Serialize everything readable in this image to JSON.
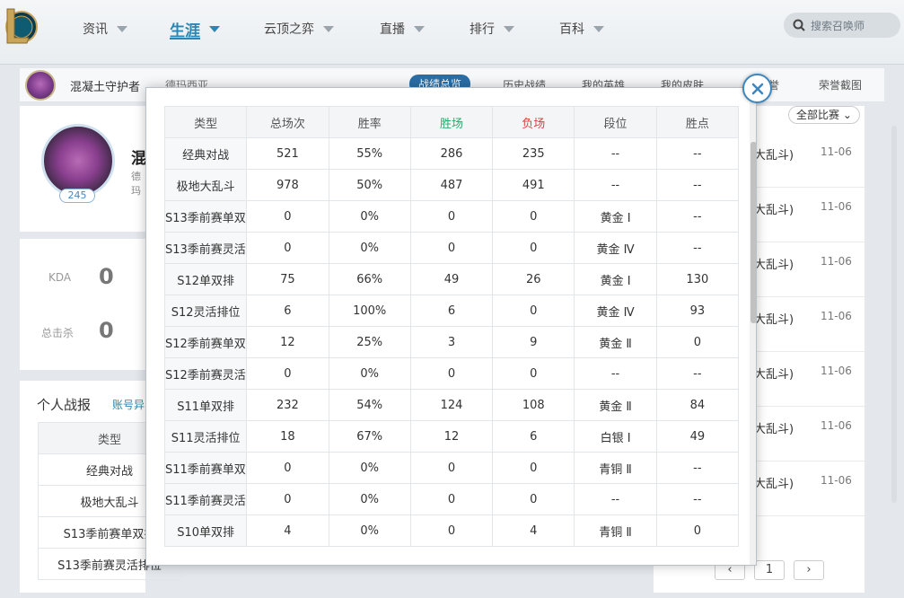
{
  "nav": {
    "items": [
      {
        "label": "资讯"
      },
      {
        "label": "生涯"
      },
      {
        "label": "云顶之弈"
      },
      {
        "label": "直播"
      },
      {
        "label": "排行"
      },
      {
        "label": "百科"
      }
    ],
    "search_placeholder": "搜索召唤师",
    "active_color": "#2b86b3"
  },
  "profile_bar": {
    "name": "混凝土守护者",
    "server": "德玛西亚",
    "tabs": [
      "战绩总览",
      "历史战绩",
      "我的英雄",
      "我的皮肤",
      "荣誉",
      "荣誉截图"
    ]
  },
  "summoner": {
    "name": "混",
    "sub": "德玛",
    "level": "245"
  },
  "kda": {
    "kda_label": "KDA",
    "kda_value": "0",
    "kills_label": "总击杀",
    "kills_value": "0"
  },
  "report": {
    "title": "个人战报",
    "link": "账号异",
    "header": "类型",
    "rows": [
      "经典对战",
      "极地大乱斗",
      "S13季前赛单双排",
      "S13季前赛灵活排位"
    ]
  },
  "matches": {
    "filter": "全部比赛",
    "rows": [
      {
        "mode": "大乱斗)",
        "date": "11-06"
      },
      {
        "mode": "大乱斗)",
        "date": "11-06"
      },
      {
        "mode": "大乱斗)",
        "date": "11-06"
      },
      {
        "mode": "大乱斗)",
        "date": "11-06"
      },
      {
        "mode": "大乱斗)",
        "date": "11-06"
      },
      {
        "mode": "大乱斗)",
        "date": "11-06"
      },
      {
        "mode": "大乱斗)",
        "date": "11-06"
      }
    ],
    "page": "1"
  },
  "modal": {
    "headers": [
      "类型",
      "总场次",
      "胜率",
      "胜场",
      "负场",
      "段位",
      "胜点"
    ],
    "win_color": "#2fa86b",
    "loss_color": "#e04040",
    "rows": [
      [
        "经典对战",
        "521",
        "55%",
        "286",
        "235",
        "--",
        "--"
      ],
      [
        "极地大乱斗",
        "978",
        "50%",
        "487",
        "491",
        "--",
        "--"
      ],
      [
        "S13季前赛单双排",
        "0",
        "0%",
        "0",
        "0",
        "黄金 Ⅰ",
        "--"
      ],
      [
        "S13季前赛灵活排位",
        "0",
        "0%",
        "0",
        "0",
        "黄金 Ⅳ",
        "--"
      ],
      [
        "S12单双排",
        "75",
        "66%",
        "49",
        "26",
        "黄金 Ⅰ",
        "130"
      ],
      [
        "S12灵活排位",
        "6",
        "100%",
        "6",
        "0",
        "黄金 Ⅳ",
        "93"
      ],
      [
        "S12季前赛单双排",
        "12",
        "25%",
        "3",
        "9",
        "黄金 Ⅱ",
        "0"
      ],
      [
        "S12季前赛灵活排位",
        "0",
        "0%",
        "0",
        "0",
        "--",
        "--"
      ],
      [
        "S11单双排",
        "232",
        "54%",
        "124",
        "108",
        "黄金 Ⅱ",
        "84"
      ],
      [
        "S11灵活排位",
        "18",
        "67%",
        "12",
        "6",
        "白银 Ⅰ",
        "49"
      ],
      [
        "S11季前赛单双排",
        "0",
        "0%",
        "0",
        "0",
        "青铜 Ⅱ",
        "--"
      ],
      [
        "S11季前赛灵活排位",
        "0",
        "0%",
        "0",
        "0",
        "--",
        "--"
      ],
      [
        "S10单双排",
        "4",
        "0%",
        "0",
        "4",
        "青铜 Ⅱ",
        "0"
      ]
    ]
  }
}
